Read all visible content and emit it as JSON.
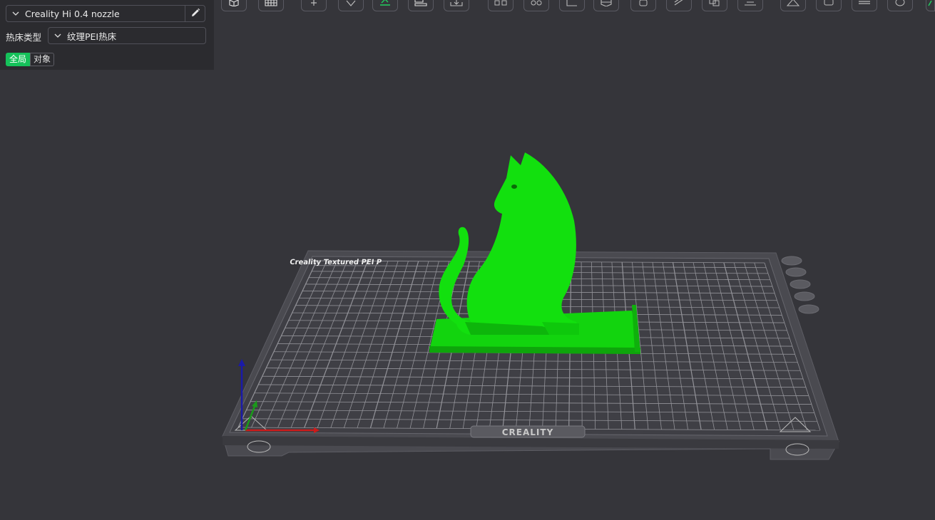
{
  "left_panel": {
    "printer": {
      "value": "Creality Hi 0.4 nozzle"
    },
    "bed_type": {
      "label": "热床类型",
      "value": "纹理PEI热床"
    },
    "scope_tabs": {
      "global": "全局",
      "object": "对象"
    }
  },
  "toolbar": {
    "buttons": [
      "cube-view-icon",
      "grid-plate-icon",
      "add-object-icon",
      "orient-icon",
      "auto-arrange-icon",
      "layout-icon",
      "import-icon",
      "split-objects-icon",
      "split-parts-icon",
      "measure-icon",
      "cut-icon",
      "support-paint-icon",
      "seam-paint-icon",
      "boolean-icon",
      "text-tool-icon",
      "assemble-icon",
      "layers-icon",
      "emboss-icon",
      "color-paint-icon"
    ]
  },
  "viewport": {
    "bed_brand": "CREALITY",
    "bed_title": "Creality Textured PEI P",
    "model_color": "#12e00e",
    "bed_side_buttons": [
      "close-icon",
      "list-icon",
      "settings-icon",
      "lock-icon",
      "gear-icon"
    ]
  },
  "colors": {
    "accent": "#15c15a",
    "background": "#35353a",
    "panel": "#2b2b2f",
    "axis_x": "#cc1a1a",
    "axis_y": "#1a9a1a",
    "axis_z": "#1a1aa8"
  }
}
